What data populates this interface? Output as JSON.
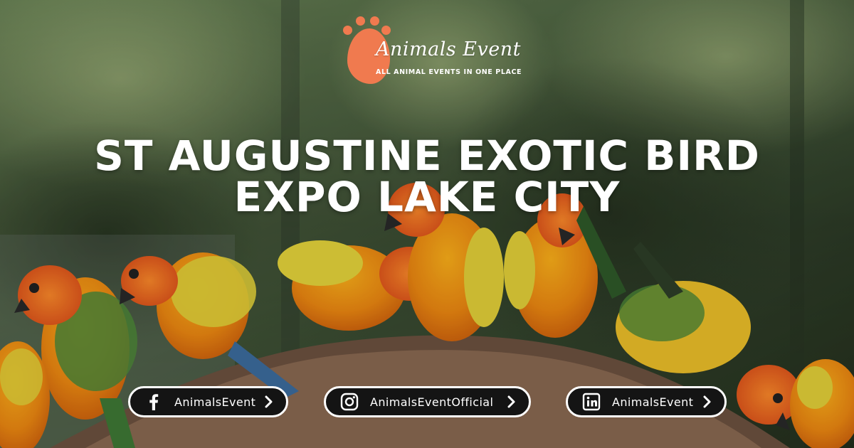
{
  "brand": {
    "name": "Animals Event",
    "tagline": "ALL ANIMAL EVENTS IN ONE PLACE",
    "accent_color": "#f07a4f"
  },
  "headline": {
    "line1": "ST AUGUSTINE EXOTIC BIRD",
    "line2": "EXPO LAKE CITY"
  },
  "social": [
    {
      "platform": "facebook",
      "icon": "facebook-icon",
      "handle": "AnimalsEvent"
    },
    {
      "platform": "instagram",
      "icon": "instagram-icon",
      "handle": "AnimalsEventOfficial"
    },
    {
      "platform": "linkedin",
      "icon": "linkedin-icon",
      "handle": "AnimalsEvent"
    }
  ],
  "colors": {
    "pill_background": "#141414",
    "pill_border": "#ffffff",
    "text": "#ffffff"
  }
}
